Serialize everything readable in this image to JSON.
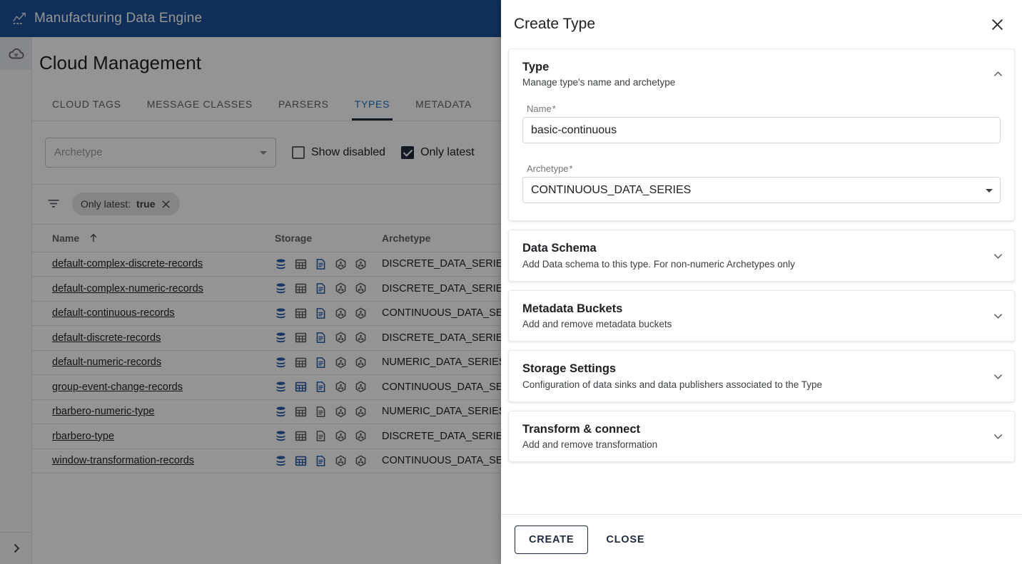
{
  "topbar": {
    "title": "Manufacturing Data Engine",
    "logo_icon": "chart-logo-icon",
    "brand_color": "#1a5299"
  },
  "rail": {
    "items": [
      {
        "icon": "cloud-icon",
        "name": "cloud"
      }
    ],
    "expand_icon": "chevron-right-icon"
  },
  "page": {
    "title": "Cloud Management"
  },
  "tabs": [
    {
      "label": "CLOUD TAGS",
      "active": false
    },
    {
      "label": "MESSAGE CLASSES",
      "active": false
    },
    {
      "label": "PARSERS",
      "active": false
    },
    {
      "label": "TYPES",
      "active": true
    },
    {
      "label": "METADATA",
      "active": false
    }
  ],
  "filters": {
    "archetype_select_placeholder": "Archetype",
    "show_disabled": {
      "label": "Show disabled",
      "checked": false
    },
    "only_latest": {
      "label": "Only latest",
      "checked": true
    },
    "chip": {
      "prefix": "Only latest:",
      "value": "true",
      "remove_icon": "close-icon"
    },
    "filter_icon": "filter-list-icon"
  },
  "table": {
    "columns": [
      {
        "key": "name",
        "label": "Name",
        "sorted": true,
        "sort_icon": "arrow-up-icon"
      },
      {
        "key": "storage",
        "label": "Storage"
      },
      {
        "key": "archetype",
        "label": "Archetype"
      }
    ],
    "rows": [
      {
        "name": "default-complex-discrete-records",
        "archetype": "DISCRETE_DATA_SERIES",
        "storage": [
          {
            "icon": "database-icon",
            "active": true
          },
          {
            "icon": "table-grid-icon",
            "active": false
          },
          {
            "icon": "document-icon",
            "active": true
          },
          {
            "icon": "hexagon-node-icon",
            "active": false
          },
          {
            "icon": "hexagon-node-icon",
            "active": false
          }
        ]
      },
      {
        "name": "default-complex-numeric-records",
        "archetype": "DISCRETE_DATA_SERIES",
        "storage": [
          {
            "icon": "database-icon",
            "active": true
          },
          {
            "icon": "table-grid-icon",
            "active": false
          },
          {
            "icon": "document-icon",
            "active": true
          },
          {
            "icon": "hexagon-node-icon",
            "active": false
          },
          {
            "icon": "hexagon-node-icon",
            "active": false
          }
        ]
      },
      {
        "name": "default-continuous-records",
        "archetype": "CONTINUOUS_DATA_SERIES",
        "storage": [
          {
            "icon": "database-icon",
            "active": true
          },
          {
            "icon": "table-grid-icon",
            "active": false
          },
          {
            "icon": "document-icon",
            "active": true
          },
          {
            "icon": "hexagon-node-icon",
            "active": false
          },
          {
            "icon": "hexagon-node-icon",
            "active": false
          }
        ]
      },
      {
        "name": "default-discrete-records",
        "archetype": "DISCRETE_DATA_SERIES",
        "storage": [
          {
            "icon": "database-icon",
            "active": true
          },
          {
            "icon": "table-grid-icon",
            "active": false
          },
          {
            "icon": "document-icon",
            "active": true
          },
          {
            "icon": "hexagon-node-icon",
            "active": false
          },
          {
            "icon": "hexagon-node-icon",
            "active": false
          }
        ]
      },
      {
        "name": "default-numeric-records",
        "archetype": "NUMERIC_DATA_SERIES",
        "storage": [
          {
            "icon": "database-icon",
            "active": true
          },
          {
            "icon": "table-grid-icon",
            "active": false
          },
          {
            "icon": "document-icon",
            "active": true
          },
          {
            "icon": "hexagon-node-icon",
            "active": false
          },
          {
            "icon": "hexagon-node-icon",
            "active": false
          }
        ]
      },
      {
        "name": "group-event-change-records",
        "archetype": "CONTINUOUS_DATA_SERIES",
        "storage": [
          {
            "icon": "database-icon",
            "active": true
          },
          {
            "icon": "table-grid-icon",
            "active": true
          },
          {
            "icon": "document-icon",
            "active": true
          },
          {
            "icon": "hexagon-node-icon",
            "active": false
          },
          {
            "icon": "hexagon-node-icon",
            "active": false
          }
        ]
      },
      {
        "name": "rbarbero-numeric-type",
        "archetype": "NUMERIC_DATA_SERIES",
        "storage": [
          {
            "icon": "database-icon",
            "active": true
          },
          {
            "icon": "table-grid-icon",
            "active": false
          },
          {
            "icon": "document-icon",
            "active": false
          },
          {
            "icon": "hexagon-node-icon",
            "active": false
          },
          {
            "icon": "hexagon-node-icon",
            "active": false
          }
        ]
      },
      {
        "name": "rbarbero-type",
        "archetype": "DISCRETE_DATA_SERIES",
        "storage": [
          {
            "icon": "database-icon",
            "active": true
          },
          {
            "icon": "table-grid-icon",
            "active": false
          },
          {
            "icon": "document-icon",
            "active": false
          },
          {
            "icon": "hexagon-node-icon",
            "active": false
          },
          {
            "icon": "hexagon-node-icon",
            "active": false
          }
        ]
      },
      {
        "name": "window-transformation-records",
        "archetype": "CONTINUOUS_DATA_SERIES",
        "storage": [
          {
            "icon": "database-icon",
            "active": true
          },
          {
            "icon": "table-grid-icon",
            "active": true
          },
          {
            "icon": "document-icon",
            "active": true
          },
          {
            "icon": "hexagon-node-icon",
            "active": false
          },
          {
            "icon": "hexagon-node-icon",
            "active": false
          }
        ]
      }
    ]
  },
  "dialog": {
    "title": "Create Type",
    "close_icon": "close-icon",
    "sections": [
      {
        "id": "type",
        "title": "Type",
        "subtitle": "Manage type's name and archetype",
        "expanded": true,
        "chevron_icon": "chevron-up-icon",
        "fields": {
          "name": {
            "label": "Name",
            "required": true,
            "value": "basic-continuous",
            "placeholder": ""
          },
          "archetype": {
            "label": "Archetype",
            "required": true,
            "value": "CONTINUOUS_DATA_SERIES",
            "caret_icon": "caret-down-icon"
          }
        }
      },
      {
        "id": "data-schema",
        "title": "Data Schema",
        "subtitle": "Add Data schema to this type. For non-numeric Archetypes only",
        "expanded": false,
        "chevron_icon": "chevron-down-icon"
      },
      {
        "id": "metadata-buckets",
        "title": "Metadata Buckets",
        "subtitle": "Add and remove metadata buckets",
        "expanded": false,
        "chevron_icon": "chevron-down-icon"
      },
      {
        "id": "storage-settings",
        "title": "Storage Settings",
        "subtitle": "Configuration of data sinks and data publishers associated to the Type",
        "expanded": false,
        "chevron_icon": "chevron-down-icon"
      },
      {
        "id": "transform-connect",
        "title": "Transform & connect",
        "subtitle": "Add and remove transformation",
        "expanded": false,
        "chevron_icon": "chevron-down-icon"
      }
    ],
    "footer": {
      "create_label": "CREATE",
      "close_label": "CLOSE"
    }
  },
  "colors": {
    "brand": "#1a5299",
    "accent": "#1a73c8",
    "icon_active": "#2a5eab",
    "icon_inactive": "#616161",
    "dark": "#1f2a3c"
  }
}
